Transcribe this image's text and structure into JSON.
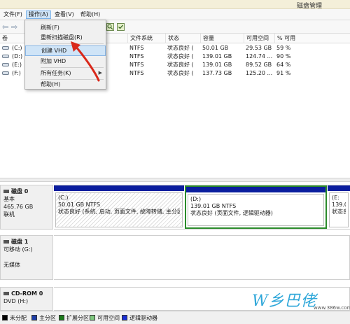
{
  "window": {
    "title": "磁盘管理"
  },
  "menubar": {
    "items": [
      "文件(F)",
      "操作(A)",
      "查看(V)",
      "帮助(H)"
    ],
    "active_index": 1
  },
  "toolbar": {
    "icons": [
      "back-arrow-icon",
      "forward-arrow-icon",
      "properties-icon",
      "help-icon"
    ],
    "back_glyph": "⇦",
    "forward_glyph": "⇨"
  },
  "volume_list": {
    "columns": [
      "卷",
      "布局",
      "类型",
      "文件系统",
      "状态",
      "容量",
      "可用空间",
      "% 可用"
    ],
    "rows": [
      {
        "volume": "(C:)",
        "filesystem": "NTFS",
        "status": "状态良好 (",
        "capacity": "50.01 GB",
        "free": "29.53 GB",
        "pct_free": "59 %"
      },
      {
        "volume": "(D:)",
        "filesystem": "NTFS",
        "status": "状态良好 (",
        "capacity": "139.01 GB",
        "free": "124.74 ...",
        "pct_free": "90 %"
      },
      {
        "volume": "(E:)",
        "filesystem": "NTFS",
        "status": "状态良好 (",
        "capacity": "139.01 GB",
        "free": "89.52 GB",
        "pct_free": "64 %"
      },
      {
        "volume": "(F:)",
        "filesystem": "NTFS",
        "status": "状态良好 (",
        "capacity": "137.73 GB",
        "free": "125.20 ...",
        "pct_free": "91 %"
      }
    ]
  },
  "dropdown": {
    "items": [
      {
        "label": "刷新(F)",
        "highlighted": false,
        "submenu": false
      },
      {
        "label": "重新扫描磁盘(R)",
        "highlighted": false,
        "submenu": false
      },
      {
        "label": "创建 VHD",
        "highlighted": true,
        "submenu": false
      },
      {
        "label": "附加 VHD",
        "highlighted": false,
        "submenu": false
      },
      {
        "label": "所有任务(K)",
        "highlighted": false,
        "submenu": true
      },
      {
        "label": "帮助(H)",
        "highlighted": false,
        "submenu": false
      }
    ],
    "submenu_glyph": "▶"
  },
  "disks": [
    {
      "name": "磁盘 0",
      "lines": [
        "基本",
        "465.76 GB",
        "联机"
      ],
      "partitions": [
        {
          "label": "(C:)",
          "size": "50.01 GB NTFS",
          "status": "状态良好 (系统, 启动, 页面文件, 故障转储, 主分区)",
          "selected": false,
          "hatched": true
        },
        {
          "label": "(D:)",
          "size": "139.01 GB NTFS",
          "status": "状态良好 (页面文件, 逻辑驱动器)",
          "selected": true,
          "hatched": false
        },
        {
          "label": "(E:",
          "size": "139.01",
          "status": "状态良",
          "selected": false,
          "hatched": false
        }
      ]
    },
    {
      "name": "磁盘 1",
      "lines": [
        "可移动 (G:)",
        "",
        "无媒体"
      ],
      "partitions": []
    },
    {
      "name": "CD-ROM 0",
      "lines": [
        "DVD (H:)"
      ],
      "partitions": []
    }
  ],
  "legend": {
    "items": [
      {
        "label": "未分配",
        "color": "#000000"
      },
      {
        "label": "主分区",
        "color": "#1f3fa8"
      },
      {
        "label": "扩展分区",
        "color": "#1a7a1a"
      },
      {
        "label": "可用空间",
        "color": "#7ec87e"
      },
      {
        "label": "逻辑驱动器",
        "color": "#1b2fd6"
      }
    ]
  },
  "watermark": {
    "text": "W乡巴佬",
    "url": "www.386w.com"
  },
  "colors": {
    "annotation_arrow": "#d9281a",
    "selection": "#2a8b2a",
    "partition_bar": "#0b1e9e"
  }
}
